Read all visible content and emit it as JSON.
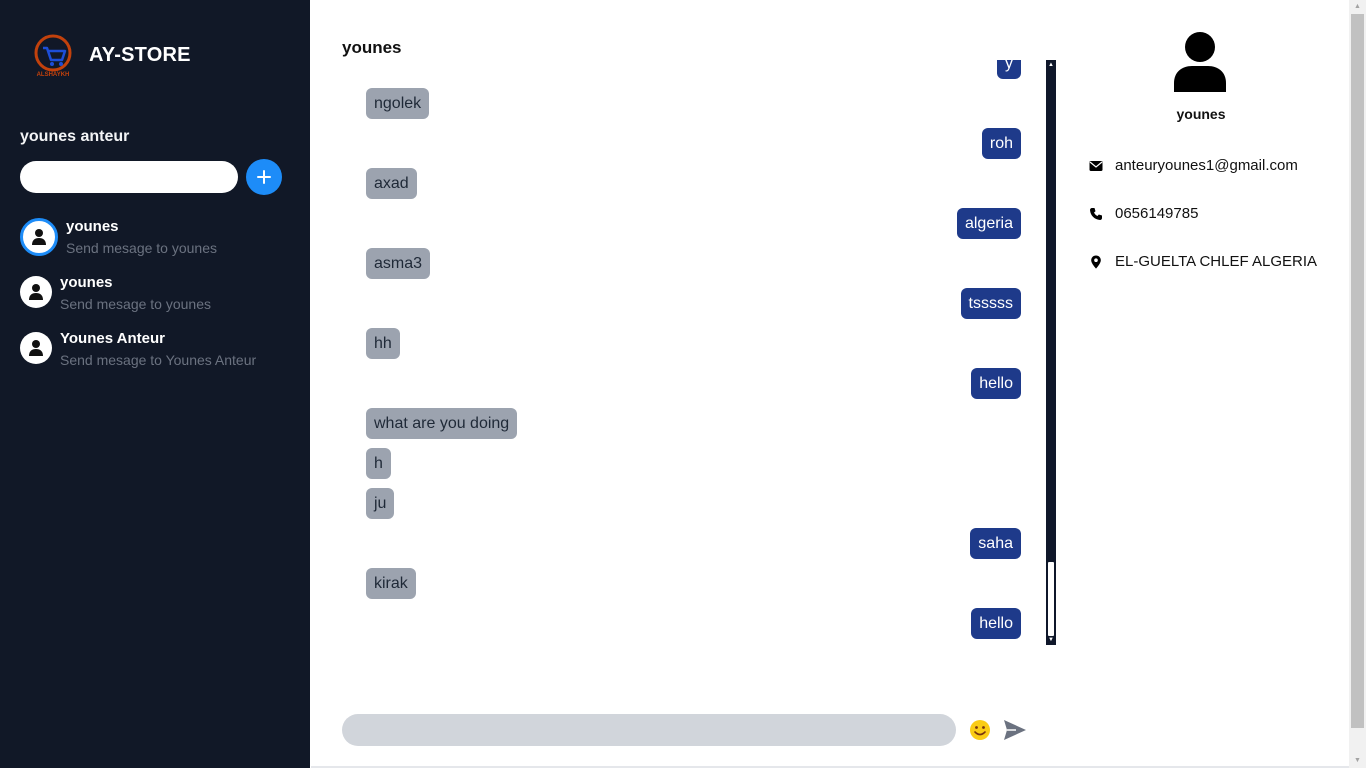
{
  "sidebar": {
    "brand": "AY-STORE",
    "logo_text": "ALSHAYKH",
    "current_user": "younes anteur",
    "search": {
      "value": "",
      "placeholder": ""
    },
    "contacts": [
      {
        "name": "younes",
        "subtitle": "Send mesage to younes",
        "active": true
      },
      {
        "name": "younes",
        "subtitle": "Send mesage to younes",
        "active": false
      },
      {
        "name": "Younes Anteur",
        "subtitle": "Send mesage to Younes Anteur",
        "active": false
      }
    ]
  },
  "chat": {
    "title": "younes",
    "messages": [
      {
        "text": "y",
        "direction": "out"
      },
      {
        "text": "ngolek",
        "direction": "in"
      },
      {
        "text": "roh",
        "direction": "out"
      },
      {
        "text": "axad",
        "direction": "in"
      },
      {
        "text": "algeria",
        "direction": "out"
      },
      {
        "text": "asma3",
        "direction": "in"
      },
      {
        "text": "tsssss",
        "direction": "out"
      },
      {
        "text": "hh",
        "direction": "in"
      },
      {
        "text": "hello",
        "direction": "out"
      },
      {
        "text": "what are you doing",
        "direction": "in"
      },
      {
        "text": "h",
        "direction": "in"
      },
      {
        "text": "ju",
        "direction": "in"
      },
      {
        "text": "saha",
        "direction": "out"
      },
      {
        "text": "kirak",
        "direction": "in"
      },
      {
        "text": "hello",
        "direction": "out"
      }
    ],
    "composer": {
      "value": "",
      "placeholder": ""
    }
  },
  "profile": {
    "name": "younes",
    "email": "anteuryounes1@gmail.com",
    "phone": "0656149785",
    "address": "EL-GUELTA CHLEF ALGERIA"
  },
  "colors": {
    "sidebar_bg": "#111827",
    "accent": "#1d8cf8",
    "bubble_in": "#9ca3af",
    "bubble_out": "#1e3a8a",
    "composer_bg": "#d1d5db",
    "emoji": "#facc15"
  }
}
